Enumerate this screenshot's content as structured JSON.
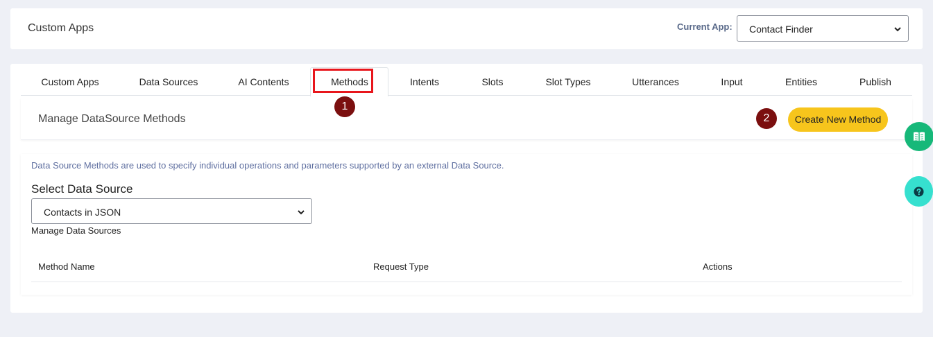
{
  "header": {
    "title": "Custom Apps",
    "current_app_label": "Current App:",
    "current_app_value": "Contact Finder"
  },
  "tabs": [
    {
      "label": "Custom Apps"
    },
    {
      "label": "Data Sources"
    },
    {
      "label": "AI Contents"
    },
    {
      "label": "Methods"
    },
    {
      "label": "Intents"
    },
    {
      "label": "Slots"
    },
    {
      "label": "Slot Types"
    },
    {
      "label": "Utterances"
    },
    {
      "label": "Input"
    },
    {
      "label": "Entities"
    },
    {
      "label": "Publish"
    }
  ],
  "active_tab": "Methods",
  "annotations": {
    "badge1": "1",
    "badge2": "2"
  },
  "section": {
    "title": "Manage DataSource Methods",
    "create_button": "Create New Method"
  },
  "body": {
    "info": "Data Source Methods are used to specify individual operations and parameters supported by an external Data Source.",
    "select_label": "Select Data Source",
    "select_value": "Contacts in JSON",
    "manage_link": "Manage Data Sources"
  },
  "table": {
    "headers": [
      "Method Name",
      "Request Type",
      "Actions"
    ]
  },
  "floating": {
    "book_icon": "book-open-icon",
    "help_icon": "question-circle-icon"
  },
  "colors": {
    "accent_yellow": "#f7c51c",
    "highlight_red": "#e8161c",
    "badge": "#7b0f0f",
    "book_green": "#16b879",
    "help_teal": "#36e0cf",
    "info_text": "#5f6fa0"
  }
}
